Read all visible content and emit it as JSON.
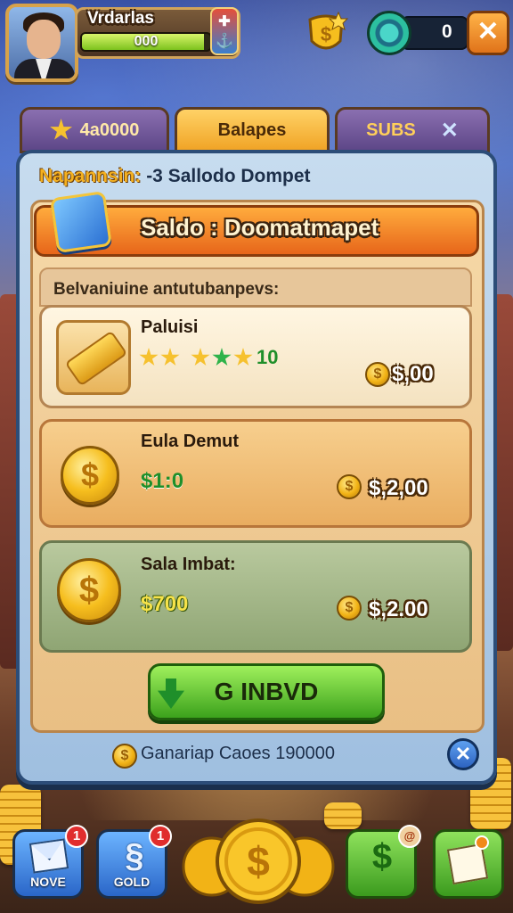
{
  "player": {
    "name": "Vrdarlas",
    "xp_value": "000",
    "xp_progress": 0.95
  },
  "top_bar": {
    "counter_value": "0",
    "close_label": "✕"
  },
  "tabs": [
    {
      "label": "4a0000"
    },
    {
      "label": "Balapes"
    },
    {
      "label": "SUBS",
      "close_label": "✕"
    }
  ],
  "panel": {
    "title_prefix": "Napannsin:",
    "title_rest": "-3 Sallodo Dompet",
    "banner": "Saldo : Doomatmapet",
    "subheader": "Belvaniuinе antutubanpevs:"
  },
  "cards": [
    {
      "title": "Paluisi",
      "value": "10",
      "price": "$,00"
    },
    {
      "title": "Eula Demut",
      "value": "$1:0",
      "price": "$,2,00"
    },
    {
      "title": "Sala Imbat:",
      "value": "$700",
      "price": "$,2.00"
    }
  ],
  "action_button": {
    "label": "G INBVD"
  },
  "footer": {
    "text": "Ganariap Caoes 190000",
    "close_label": "✕"
  },
  "nav": {
    "news": {
      "label": "NOVE",
      "badge": "1"
    },
    "gold": {
      "label": "GOLD",
      "badge": "1"
    },
    "cash": {
      "badge": "@"
    }
  },
  "colors": {
    "accent_orange": "#e7661a",
    "panel_blue": "#2c4d78",
    "green": "#3ca21c",
    "gold": "#f6be1e"
  }
}
